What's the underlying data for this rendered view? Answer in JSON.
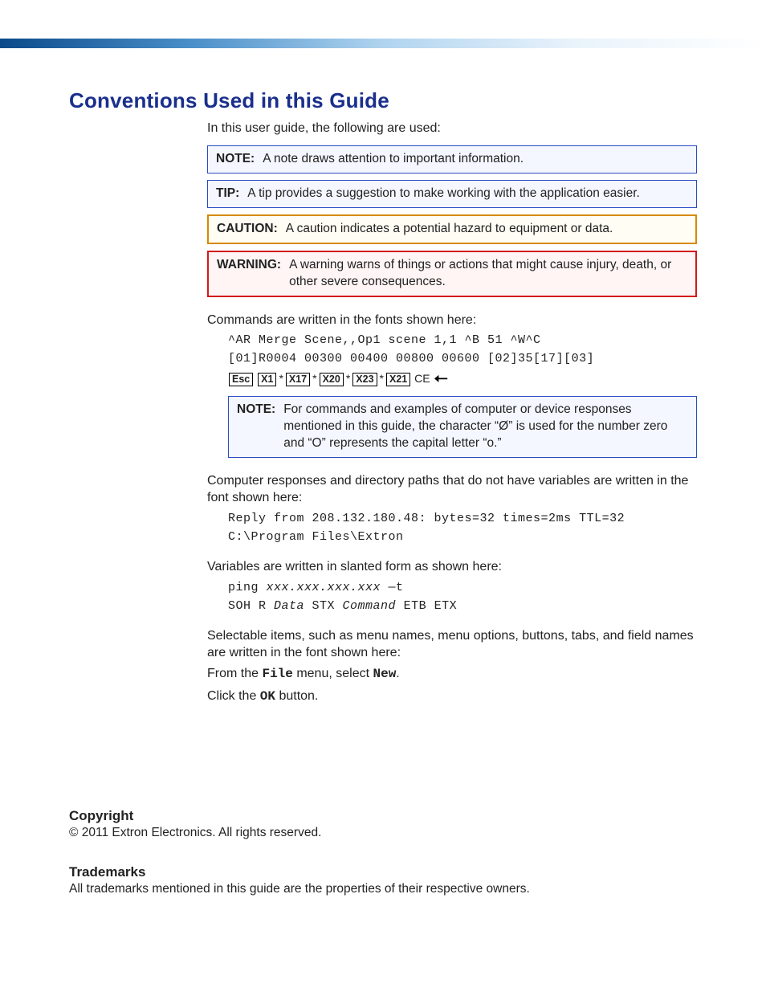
{
  "title": "Conventions Used in this Guide",
  "intro": "In this user guide, the following are used:",
  "callouts": {
    "note": {
      "label": "NOTE:",
      "text": "A note draws attention to important information."
    },
    "tip": {
      "label": "TIP:",
      "text": "A tip provides a suggestion to make working with the application easier."
    },
    "caution": {
      "label": "CAUTION:",
      "text": "A caution indicates a potential hazard to equipment or data."
    },
    "warning": {
      "label": "WARNING:",
      "text": "A warning warns of things or actions that might cause injury, death, or other severe consequences."
    }
  },
  "commands_intro": "Commands are written in the fonts shown here:",
  "cmd_line1": "^AR Merge Scene,,Op1 scene 1,1 ^B 51 ^W^C",
  "cmd_line2": "[01]R0004 00300 00400 00800 00600 [02]35[17][03]",
  "esc": {
    "esc": "Esc",
    "x1": "X1",
    "x17": "X17",
    "x20": "X20",
    "x23": "X23",
    "x21": "X21",
    "ce": "CE"
  },
  "note2": {
    "label": "NOTE:",
    "text": "For commands and examples of computer or device responses mentioned in this guide, the character “Ø” is used for the number zero and “O” represents the capital letter “o.”"
  },
  "responses_intro": "Computer responses and directory paths that do not have variables are written in the font shown here:",
  "resp_line1": "Reply from 208.132.180.48: bytes=32 times=2ms TTL=32",
  "resp_line2": "C:\\Program Files\\Extron",
  "variables_intro": "Variables are written in slanted form as shown here:",
  "var_line1_pre": "ping ",
  "var_line1_var": "xxx.xxx.xxx.xxx",
  "var_line1_post": " —t",
  "var_line2_1": "SOH R ",
  "var_line2_2": "Data",
  "var_line2_3": " STX ",
  "var_line2_4": "Command",
  "var_line2_5": " ETB ETX",
  "selectable_intro": "Selectable items, such as menu names, menu options, buttons, tabs, and field names are written in the font shown here:",
  "sel_line1_pre": "From the ",
  "sel_line1_b1": "File",
  "sel_line1_mid": " menu, select ",
  "sel_line1_b2": "New",
  "sel_line1_post": ".",
  "sel_line2_pre": "Click the ",
  "sel_line2_b": "OK",
  "sel_line2_post": " button.",
  "footer": {
    "copyright_h": "Copyright",
    "copyright_t": "© 2011  Extron Electronics. All rights reserved.",
    "trademarks_h": "Trademarks",
    "trademarks_t": "All trademarks mentioned in this guide are the properties of their respective owners."
  }
}
